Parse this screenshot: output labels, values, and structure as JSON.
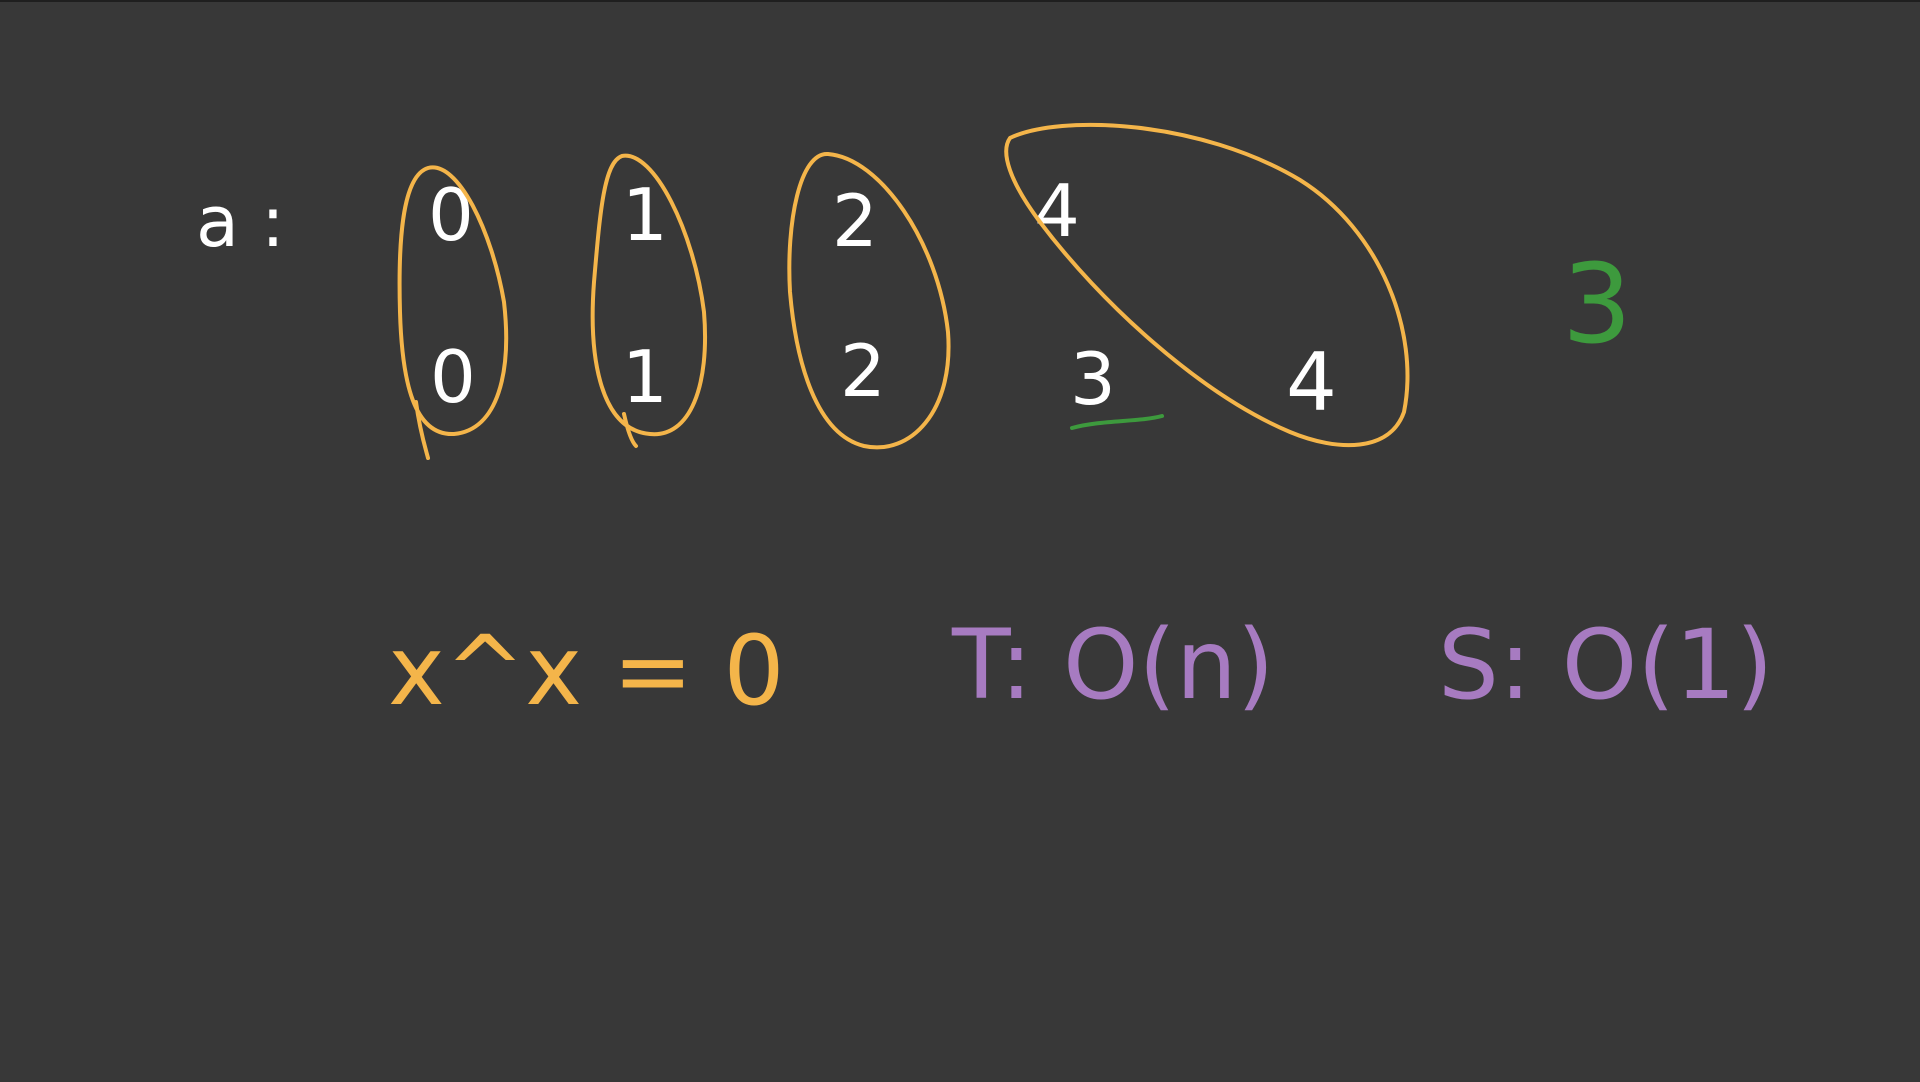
{
  "colors": {
    "background": "#383838",
    "chalk_white": "#ffffff",
    "highlight_orange": "#f4b54a",
    "answer_green": "#3d9a3d",
    "complexity_purple": "#a77bc1"
  },
  "board": {
    "array_label": "a :",
    "row_top": [
      "0",
      "1",
      "2",
      "4"
    ],
    "row_bottom": [
      "0",
      "1",
      "2",
      "3",
      "4"
    ],
    "answer": "3",
    "xor_rule": "x^x = 0",
    "time_complexity": "T: O(n)",
    "space_complexity": "S: O(1)"
  }
}
